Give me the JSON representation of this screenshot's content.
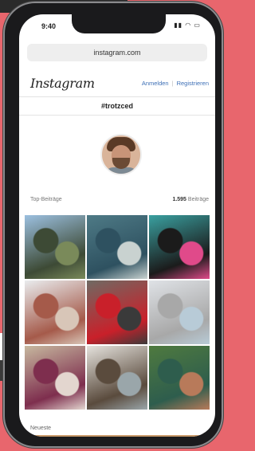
{
  "status": {
    "time": "9:40",
    "icons": "▮▮ ◠ ▭"
  },
  "browser": {
    "url": "instagram.com"
  },
  "header": {
    "logo": "Instagram",
    "login": "Anmelden",
    "register": "Registrieren"
  },
  "hashtag": "#trotzced",
  "stats": {
    "top_label": "Top-Beiträge",
    "count": "1.595",
    "count_label": "Beiträge"
  },
  "latest_label": "Neueste",
  "grid": [
    {
      "colors": [
        "#9cc0e0",
        "#3d4a35",
        "#7a8a5a"
      ]
    },
    {
      "colors": [
        "#4e7a86",
        "#2e5160",
        "#c9d2d0"
      ]
    },
    {
      "colors": [
        "#3aa0a0",
        "#1b1b1b",
        "#e04a8a"
      ]
    },
    {
      "colors": [
        "#e9ecee",
        "#a55a4a",
        "#d8c6b8"
      ]
    },
    {
      "colors": [
        "#6f6a63",
        "#c9202a",
        "#3a3a3a"
      ]
    },
    {
      "colors": [
        "#dfe2e6",
        "#a8a8a8",
        "#b8cbd7"
      ]
    },
    {
      "colors": [
        "#c7b89f",
        "#7e2e4e",
        "#e3d6cf"
      ]
    },
    {
      "colors": [
        "#e5e2dd",
        "#5a4b3d",
        "#9aa6aa"
      ]
    },
    {
      "colors": [
        "#4f7a3f",
        "#2e5d4d",
        "#b87a5a"
      ]
    }
  ],
  "colors": {
    "link": "#3d6fb6",
    "background": "#e8666d"
  }
}
